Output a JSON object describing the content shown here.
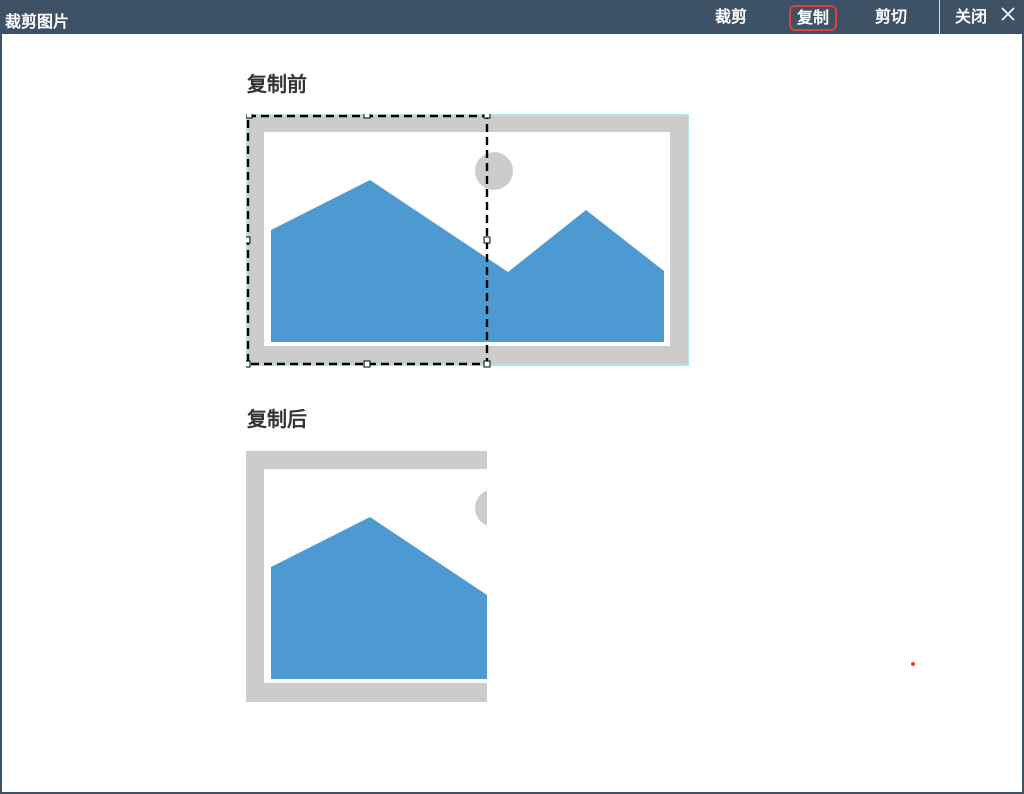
{
  "window": {
    "title": "裁剪图片",
    "close_label": "关闭"
  },
  "toolbar": {
    "crop_label": "裁剪",
    "copy_label": "复制",
    "cut_label": "剪切"
  },
  "sections": {
    "before_label": "复制前",
    "after_label": "复制后"
  },
  "colors": {
    "titlebar": "#3d5266",
    "accent_outline": "#e0403a",
    "mountain": "#4d9ad2",
    "frame": "#cccccc",
    "selection_border": "#5bd0d0"
  },
  "icons": {
    "close": "close-icon",
    "image_placeholder": "landscape-image"
  }
}
